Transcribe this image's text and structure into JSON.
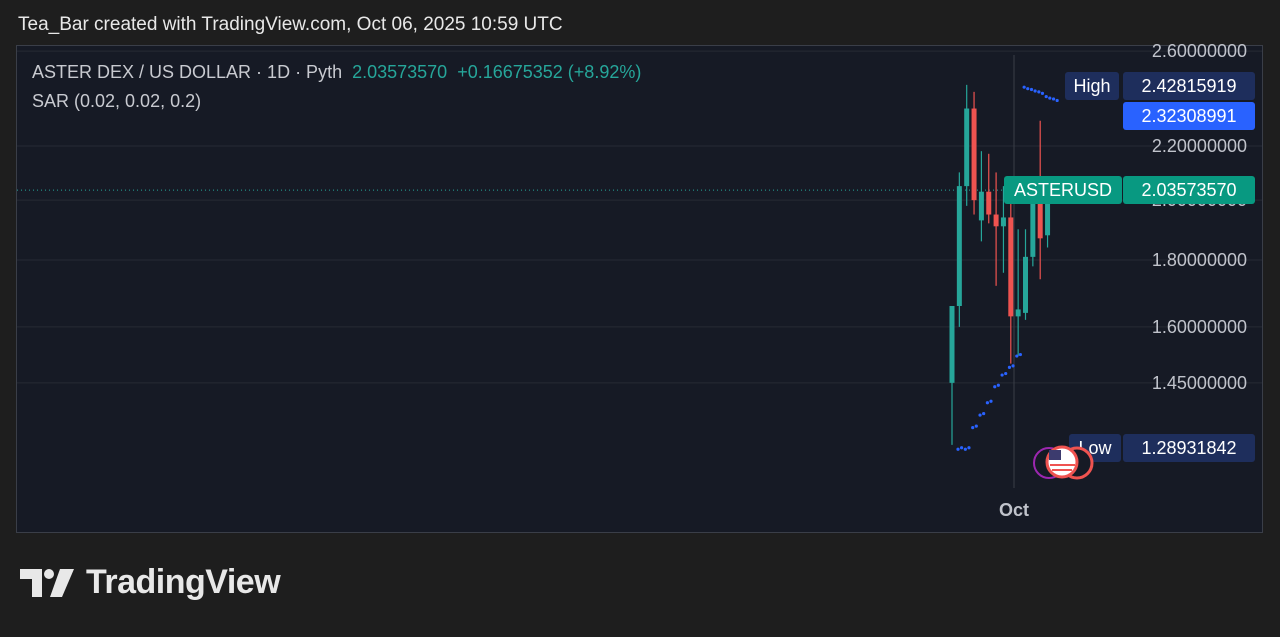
{
  "header": {
    "attribution": "Tea_Bar created with TradingView.com, Oct 06, 2025 10:59 UTC"
  },
  "legend": {
    "symbol": "ASTER DEX / US DOLLAR · 1D · Pyth",
    "price": "2.03573570",
    "change": "+0.16675352 (+8.92%)",
    "indicator": "SAR (0.02, 0.02, 0.2)"
  },
  "colors": {
    "up": "#26a69a",
    "down": "#ef5350",
    "sar": "#2962ff",
    "high_tag": "#1e2e5c",
    "last_tag": "#2962ff",
    "ticker_tag": "#089981"
  },
  "tags": {
    "high_label": "High",
    "high_value": "2.42815919",
    "blue_value": "2.32308991",
    "ticker_label": "ASTERUSD",
    "ticker_value": "2.03573570",
    "low_label": "Low",
    "low_value": "1.28931842"
  },
  "brand": {
    "name": "TradingView"
  },
  "chart_data": {
    "type": "candlestick",
    "y_scale": "log",
    "y_ticks": [
      "2.60000000",
      "2.20000000",
      "2.00000000",
      "1.80000000",
      "1.60000000",
      "1.45000000"
    ],
    "x_ticks": [
      "Oct"
    ],
    "candles": [
      {
        "o": 1.45,
        "h": 1.66,
        "l": 1.3,
        "c": 1.66
      },
      {
        "o": 1.66,
        "h": 2.1,
        "l": 1.6,
        "c": 2.05
      },
      {
        "o": 2.05,
        "h": 2.45,
        "l": 1.98,
        "c": 2.35
      },
      {
        "o": 2.35,
        "h": 2.42,
        "l": 1.95,
        "c": 2.0
      },
      {
        "o": 1.93,
        "h": 2.18,
        "l": 1.86,
        "c": 2.03
      },
      {
        "o": 2.03,
        "h": 2.17,
        "l": 1.92,
        "c": 1.95
      },
      {
        "o": 1.95,
        "h": 2.1,
        "l": 1.72,
        "c": 1.91
      },
      {
        "o": 1.91,
        "h": 2.05,
        "l": 1.76,
        "c": 1.94
      },
      {
        "o": 1.94,
        "h": 2.0,
        "l": 1.5,
        "c": 1.63
      },
      {
        "o": 1.63,
        "h": 1.9,
        "l": 1.52,
        "c": 1.65
      },
      {
        "o": 1.64,
        "h": 1.9,
        "l": 1.62,
        "c": 1.81
      },
      {
        "o": 1.81,
        "h": 2.06,
        "l": 1.78,
        "c": 2.04
      },
      {
        "o": 2.08,
        "h": 2.3,
        "l": 1.74,
        "c": 1.87
      },
      {
        "o": 1.88,
        "h": 2.06,
        "l": 1.84,
        "c": 2.04
      }
    ],
    "sar": [
      1.29,
      1.29,
      1.34,
      1.37,
      1.4,
      1.44,
      1.47,
      1.49,
      1.52,
      2.44,
      2.43,
      2.42,
      2.4,
      2.39
    ],
    "last_price": 2.0357357,
    "high": 2.42815919,
    "low": 1.28931842
  }
}
